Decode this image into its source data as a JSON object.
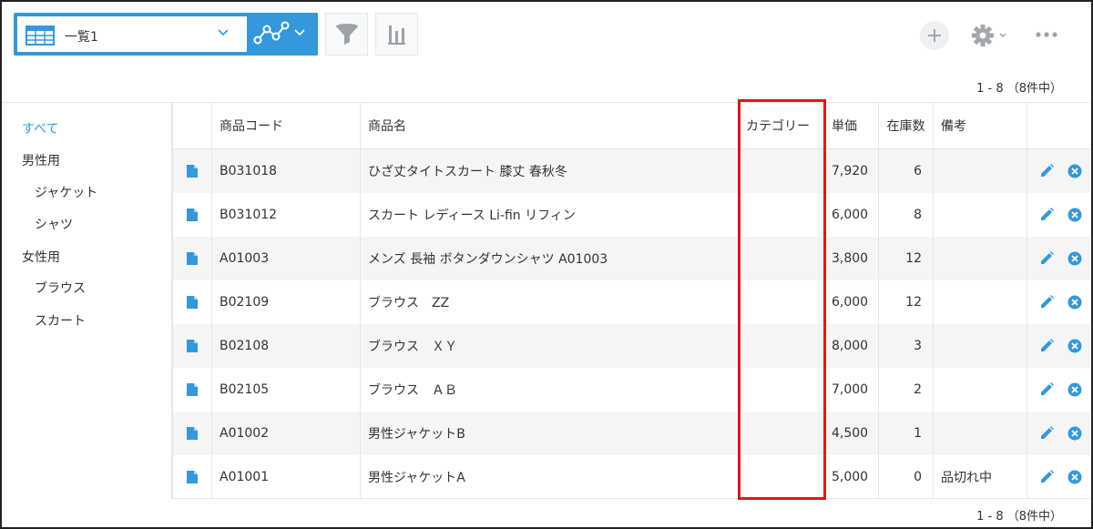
{
  "toolbar": {
    "view_name": "一覧1",
    "icons": {
      "view": "table-grid-icon",
      "graph": "graph-line-icon",
      "filter": "filter-funnel-icon",
      "stats": "bar-stats-icon",
      "add": "plus-icon",
      "settings": "gear-icon",
      "more": "more-dots-icon"
    }
  },
  "pager": {
    "top": "1 - 8 （8件中）",
    "bottom": "1 - 8 （8件中）"
  },
  "sidebar": {
    "items": [
      {
        "label": "すべて",
        "active": true
      },
      {
        "label": "男性用"
      },
      {
        "label": "ジャケット"
      },
      {
        "label": "シャツ"
      },
      {
        "label": "女性用"
      },
      {
        "label": "ブラウス"
      },
      {
        "label": "スカート"
      }
    ]
  },
  "table": {
    "columns": {
      "code": "商品コード",
      "name": "商品名",
      "category": "カテゴリー",
      "price": "単価",
      "stock": "在庫数",
      "note": "備考"
    },
    "rows": [
      {
        "code": "B031018",
        "name": "ひざ丈タイトスカート 膝丈 春秋冬",
        "category": "",
        "price": "7,920",
        "stock": "6",
        "note": ""
      },
      {
        "code": "B031012",
        "name": "スカート レディース Li-fin リフィン",
        "category": "",
        "price": "6,000",
        "stock": "8",
        "note": ""
      },
      {
        "code": "A01003",
        "name": "メンズ 長袖 ボタンダウンシャツ A01003",
        "category": "",
        "price": "3,800",
        "stock": "12",
        "note": ""
      },
      {
        "code": "B02109",
        "name": "ブラウス　ZZ",
        "category": "",
        "price": "6,000",
        "stock": "12",
        "note": ""
      },
      {
        "code": "B02108",
        "name": "ブラウス　ＸＹ",
        "category": "",
        "price": "8,000",
        "stock": "3",
        "note": ""
      },
      {
        "code": "B02105",
        "name": "ブラウス　ＡＢ",
        "category": "",
        "price": "7,000",
        "stock": "2",
        "note": ""
      },
      {
        "code": "A01002",
        "name": "男性ジャケットB",
        "category": "",
        "price": "4,500",
        "stock": "1",
        "note": ""
      },
      {
        "code": "A01001",
        "name": "男性ジャケットA",
        "category": "",
        "price": "5,000",
        "stock": "0",
        "note": "品切れ中"
      }
    ]
  },
  "colors": {
    "accent": "#3498db",
    "highlight": "#e3141b",
    "row_alt": "#f5f5f5"
  }
}
